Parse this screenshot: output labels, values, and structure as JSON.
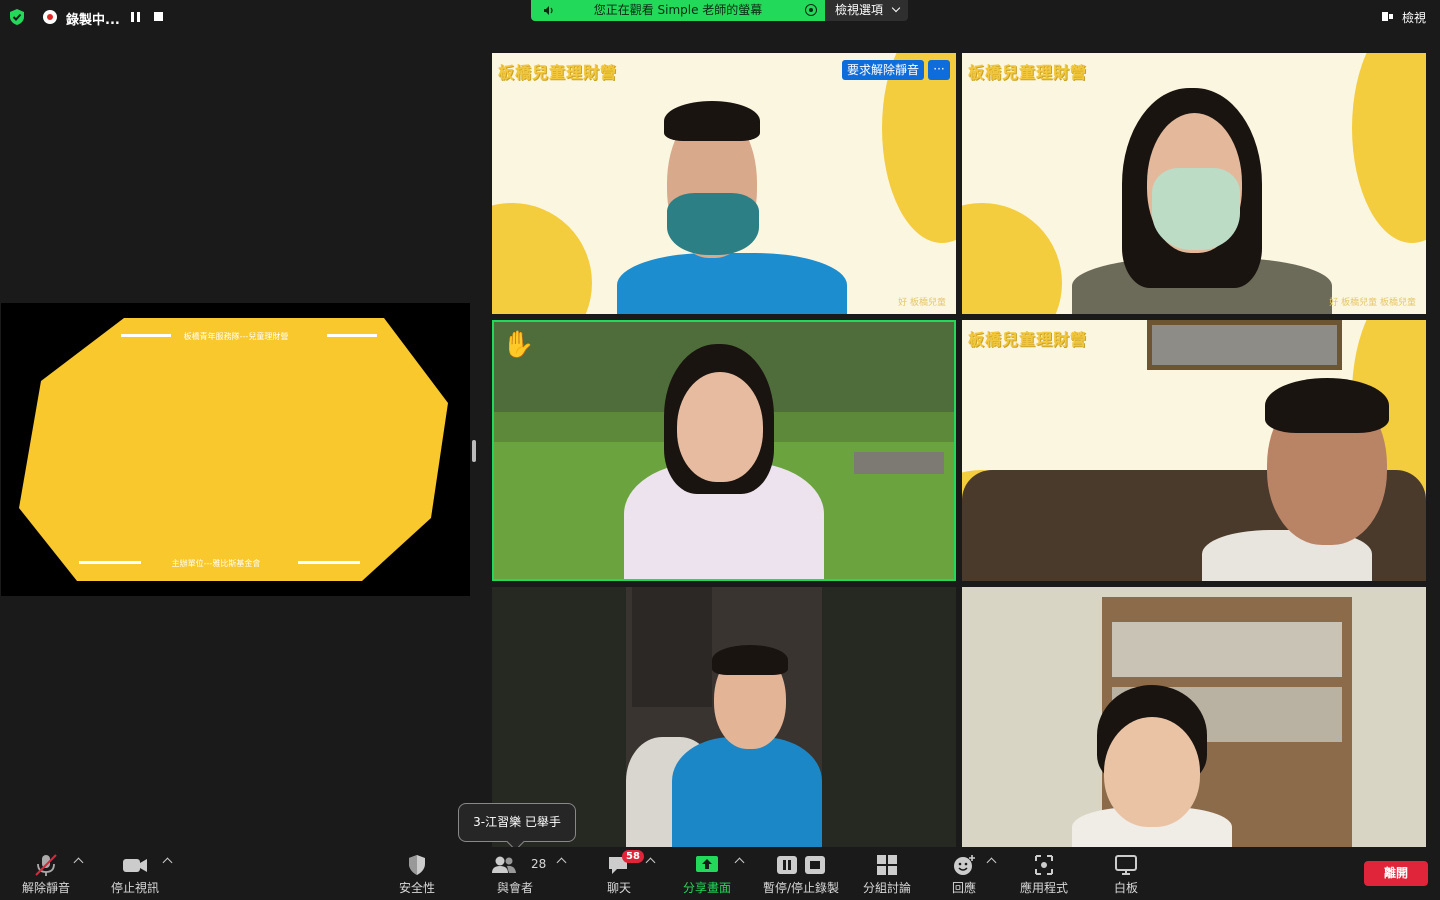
{
  "top_bar": {
    "recording_label": "錄製中...",
    "viewing_banner": "您正在觀看 Simple 老師的螢幕",
    "view_options": "檢視選項",
    "view_button": "檢視"
  },
  "shared_screen": {
    "header_text": "板橋青年服務隊---兒童理財營",
    "footer_text": "主辦單位---雅比斯基金會"
  },
  "tiles": [
    {
      "banner": "板橋兒童理財營",
      "footer": "好 板橋兒童",
      "unmute_request": "要求解除靜音",
      "more": "···"
    },
    {
      "banner": "板橋兒童理財營",
      "footer": "好 板橋兒童 板橋兒童"
    },
    {
      "raised_hand": "✋"
    },
    {
      "banner": "板橋兒童理財營"
    },
    {},
    {}
  ],
  "tooltip": "3-江習樂 已舉手",
  "toolbar": {
    "unmute": "解除靜音",
    "stop_video": "停止視訊",
    "security": "安全性",
    "participants": "與會者",
    "participant_count": "28",
    "chat": "聊天",
    "chat_badge": "58",
    "share_screen": "分享畫面",
    "pause_stop_recording": "暫停/停止錄製",
    "breakout_rooms": "分組討論",
    "reactions": "回應",
    "apps": "應用程式",
    "whiteboard": "白板",
    "leave": "離開"
  },
  "colors": {
    "accent_green": "#23d959",
    "leave_red": "#e0243a",
    "share_yellow": "#f8c82c",
    "unmute_blue": "#0e6ddb"
  }
}
